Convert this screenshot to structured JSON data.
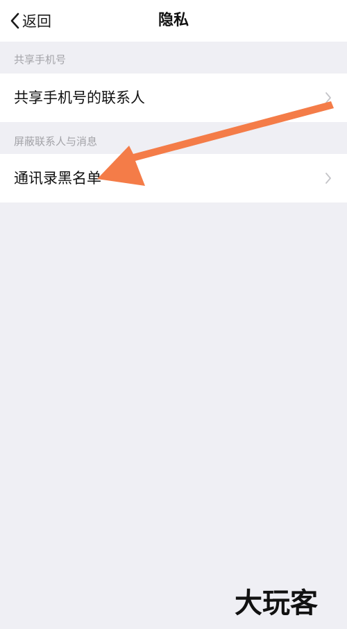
{
  "navbar": {
    "back_label": "返回",
    "title": "隐私"
  },
  "sections": [
    {
      "header": "共享手机号",
      "items": [
        {
          "label": "共享手机号的联系人"
        }
      ]
    },
    {
      "header": "屏蔽联系人与消息",
      "items": [
        {
          "label": "通讯录黑名单"
        }
      ]
    }
  ],
  "annotation": {
    "arrow_color": "#f47c48"
  },
  "watermark": {
    "text": "大玩客"
  },
  "colors": {
    "background": "#efeff4",
    "cell": "#ffffff",
    "section_text": "#a3a3a8",
    "chevron": "#c4c4c8"
  }
}
